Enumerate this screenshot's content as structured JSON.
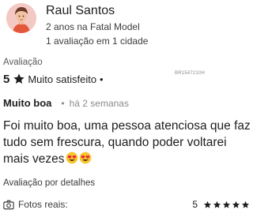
{
  "profile": {
    "name": "Raul Santos",
    "tenure": "2 anos na Fatal Model",
    "summary": "1 avaliação em 1 cidade",
    "avatar_icon": "person-avatar-icon"
  },
  "rating": {
    "label": "Avaliação",
    "score": "5",
    "score_text": "Muito satisfeito",
    "bullet": "•",
    "code": "BR1547210H",
    "star_icon": "star-icon",
    "star_color": "#1e1e1e"
  },
  "review": {
    "title": "Muito boa",
    "separator": "•",
    "time": "há 2 semanas",
    "body": "Foi muito boa, uma pessoa atenciosa que faz tudo sem frescura, quando poder voltarei mais vezes",
    "emojis": [
      "heart-eyes-emoji",
      "heart-eyes-emoji"
    ]
  },
  "details": {
    "label": "Avaliação por detalhes",
    "items": [
      {
        "label": "Fotos reais:",
        "score": "5",
        "stars": 5,
        "icon": "camera-icon"
      }
    ]
  }
}
